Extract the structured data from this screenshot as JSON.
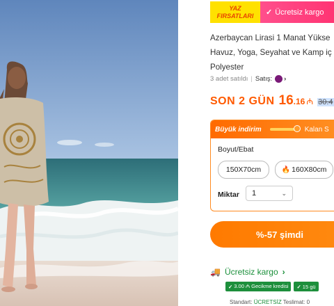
{
  "promo": {
    "yaz_line1": "YAZ",
    "yaz_line2": "FIRSATLARI",
    "kargo_label": "Ücretsiz kargo"
  },
  "product": {
    "title_lines": [
      "Azerbaycan Lirasi 1 Manat Yükse",
      "Havuz, Yoga, Seyahat ve Kamp iç",
      "Polyester"
    ],
    "sold_text": "3 adet satıldı",
    "seller_label": "Satış:"
  },
  "price": {
    "son_label": "SON 2 GÜN",
    "main": "16",
    "decimal": ".16",
    "currency": "₼",
    "old": "30.4"
  },
  "panel": {
    "header_label": "Büyük indirim",
    "kalan_label": "Kalan S",
    "boyut_label": "Boyut/Ebat",
    "options": [
      "150X70cm",
      "160X80cm"
    ],
    "miktar_label": "Miktar",
    "quantity": "1"
  },
  "cta": {
    "label": "%-57 şimdi"
  },
  "shipping": {
    "label": "Ücretsiz kargo",
    "badge1": "3.00 ₼ Gecikme kredisi",
    "badge2": "15 gü",
    "standard_label": "Standart:",
    "standard_value": "ÜCRETSİZ",
    "teslimat_label": "Teslimat: 0"
  },
  "colors": {
    "accent_orange": "#ff6a00",
    "promo_pink": "#ff3b78",
    "promo_yellow": "#ffe100",
    "ship_green": "#1a8f3a"
  }
}
